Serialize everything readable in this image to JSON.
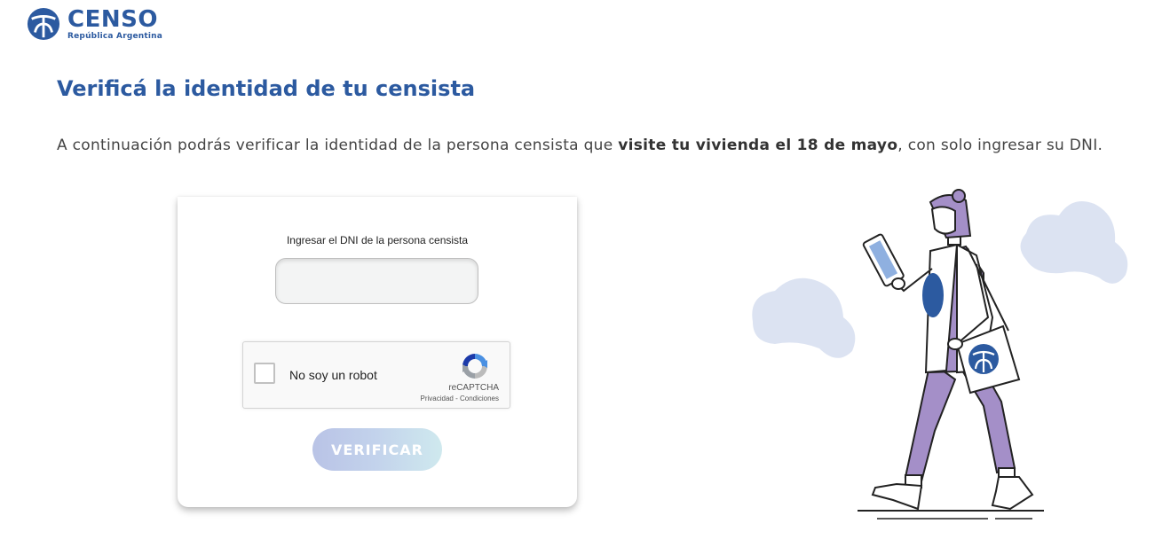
{
  "header": {
    "logo_title": "CENSO",
    "logo_subtitle": "República Argentina"
  },
  "main": {
    "title": "Verificá la identidad de tu censista",
    "intro_prefix": "A continuación podrás verificar la identidad de la persona censista que ",
    "intro_bold": "visite tu vivienda el 18 de mayo",
    "intro_suffix": ", con solo ingresar su DNI."
  },
  "form": {
    "dni_label": "Ingresar el DNI de la persona censista",
    "dni_value": "",
    "dni_placeholder": "",
    "verify_label": "VERIFICAR"
  },
  "recaptcha": {
    "label": "No soy un robot",
    "brand": "reCAPTCHA",
    "links": "Privacidad - Condiciones"
  },
  "colors": {
    "brand_blue": "#2c5aa0",
    "accent_purple": "#a48fc8",
    "blob_blue": "#dce3f2"
  },
  "icons": {
    "logo": "censo-logo-icon",
    "recaptcha": "recaptcha-logo-icon",
    "illustration": "census-worker-illustration"
  }
}
